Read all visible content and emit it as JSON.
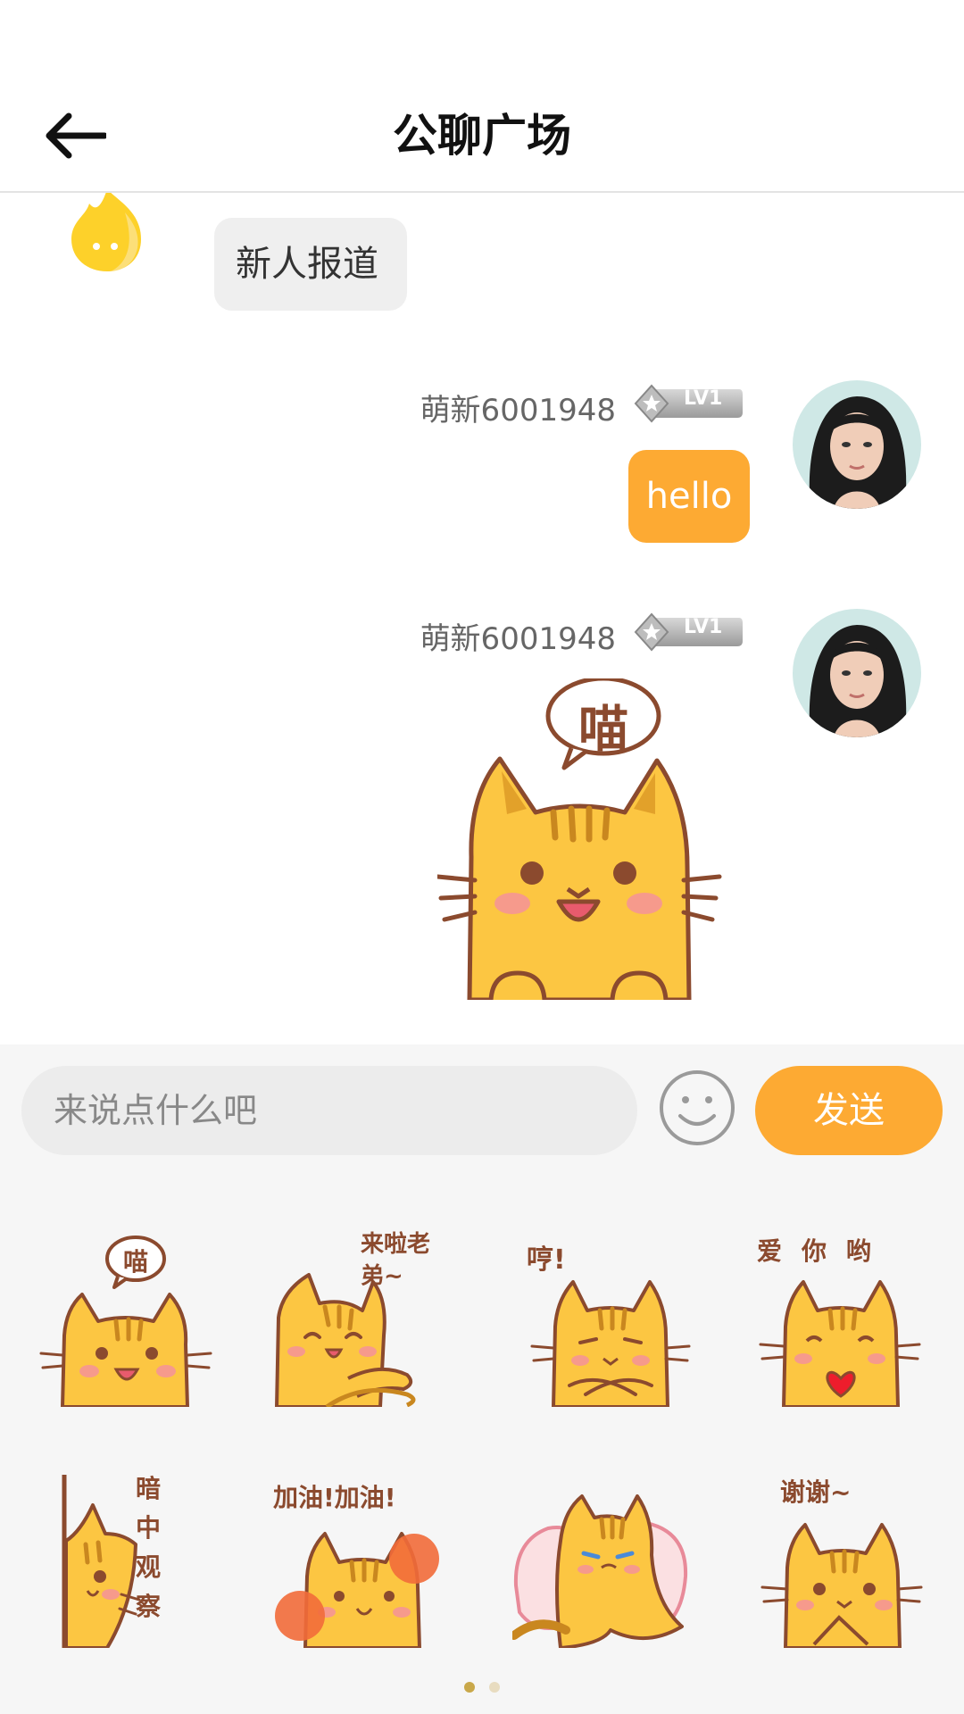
{
  "header": {
    "title": "公聊广场"
  },
  "messages": [
    {
      "side": "left",
      "text": "新人报道"
    },
    {
      "side": "right",
      "user": "萌新6001948",
      "level": "LV1",
      "text": "hello"
    },
    {
      "side": "right",
      "user": "萌新6001948",
      "level": "LV1",
      "sticker_text": "喵"
    }
  ],
  "input": {
    "placeholder": "来说点什么吧",
    "send_label": "发送"
  },
  "stickers": [
    {
      "icon": "cat-meow-sticker",
      "text": "喵"
    },
    {
      "icon": "cat-come-brother-sticker",
      "text": "来啦老弟~"
    },
    {
      "icon": "cat-hmph-sticker",
      "text": "哼!"
    },
    {
      "icon": "cat-love-you-sticker",
      "text": "爱你哟"
    },
    {
      "icon": "cat-peek-sticker",
      "text": "暗中观察"
    },
    {
      "icon": "cat-cheer-sticker",
      "text": "加油!加油!"
    },
    {
      "icon": "cat-cry-sticker",
      "text": ""
    },
    {
      "icon": "cat-thanks-sticker",
      "text": "谢谢~"
    }
  ],
  "colors": {
    "accent": "#fdaa33",
    "bubble_gray": "#efefef",
    "cat_yellow": "#fcc642",
    "cat_outline": "#8b4a2e",
    "dot_active": "#c9a84a",
    "dot_inactive": "#e8dcc0"
  }
}
